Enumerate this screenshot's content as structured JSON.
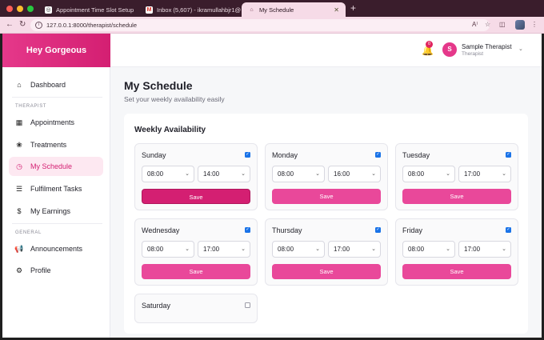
{
  "browser": {
    "tabs": [
      {
        "title": "Appointment Time Slot Setup",
        "active": false
      },
      {
        "title": "Inbox (5,607) - ikramullahbjr1@",
        "active": false
      },
      {
        "title": "My Schedule",
        "active": true
      }
    ],
    "url": "127.0.0.1:8000/therapist/schedule"
  },
  "sidebar": {
    "brand": "Hey Gorgeous",
    "items": [
      {
        "label": "Dashboard",
        "icon": "home-icon"
      },
      {
        "section": "THERAPIST"
      },
      {
        "label": "Appointments",
        "icon": "calendar-icon"
      },
      {
        "label": "Treatments",
        "icon": "lotus-icon"
      },
      {
        "label": "My Schedule",
        "icon": "clock-icon",
        "active": true
      },
      {
        "label": "Fulfilment Tasks",
        "icon": "list-icon"
      },
      {
        "label": "My Earnings",
        "icon": "dollar-icon"
      },
      {
        "section": "GENERAL"
      },
      {
        "label": "Announcements",
        "icon": "megaphone-icon"
      },
      {
        "label": "Profile",
        "icon": "user-gear-icon"
      }
    ]
  },
  "topbar": {
    "notification_count": "0",
    "avatar_initial": "S",
    "user_name": "Sample Therapist",
    "user_role": "Therapist"
  },
  "page": {
    "title": "My Schedule",
    "subtitle": "Set your weekly availability easily"
  },
  "availability": {
    "title": "Weekly Availability",
    "save_label": "Save",
    "days": [
      {
        "name": "Sunday",
        "enabled": true,
        "start": "08:00",
        "end": "14:00"
      },
      {
        "name": "Monday",
        "enabled": true,
        "start": "08:00",
        "end": "16:00"
      },
      {
        "name": "Tuesday",
        "enabled": true,
        "start": "08:00",
        "end": "17:00"
      },
      {
        "name": "Wednesday",
        "enabled": true,
        "start": "08:00",
        "end": "17:00"
      },
      {
        "name": "Thursday",
        "enabled": true,
        "start": "08:00",
        "end": "17:00"
      },
      {
        "name": "Friday",
        "enabled": true,
        "start": "08:00",
        "end": "17:00"
      },
      {
        "name": "Saturday",
        "enabled": false
      }
    ]
  }
}
